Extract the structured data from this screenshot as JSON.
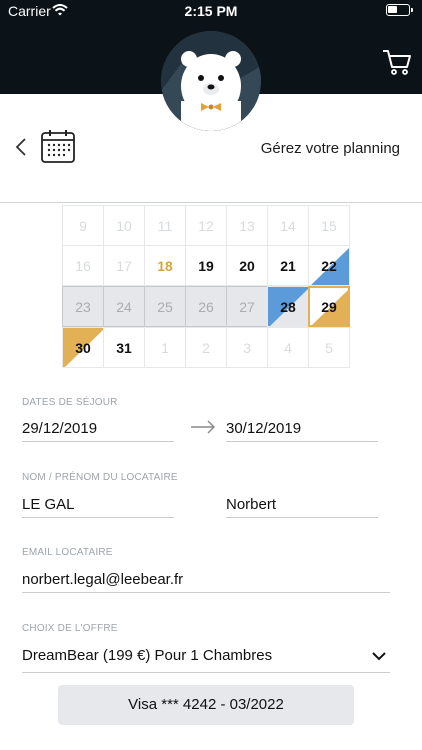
{
  "status_bar": {
    "carrier": "Carrier",
    "time": "2:15 PM"
  },
  "header": {
    "title": "Gérez votre planning"
  },
  "calendar": {
    "rows": [
      [
        {
          "d": "9",
          "s": "faded"
        },
        {
          "d": "10",
          "s": "faded"
        },
        {
          "d": "11",
          "s": "faded"
        },
        {
          "d": "12",
          "s": "faded"
        },
        {
          "d": "13",
          "s": "faded"
        },
        {
          "d": "14",
          "s": "faded"
        },
        {
          "d": "15",
          "s": "faded"
        }
      ],
      [
        {
          "d": "16",
          "s": "faded"
        },
        {
          "d": "17",
          "s": "faded"
        },
        {
          "d": "18",
          "s": "today"
        },
        {
          "d": "19",
          "s": "active"
        },
        {
          "d": "20",
          "s": "active"
        },
        {
          "d": "21",
          "s": "active"
        },
        {
          "d": "22",
          "s": "active-blue-start"
        }
      ],
      [
        {
          "d": "23",
          "s": "booked"
        },
        {
          "d": "24",
          "s": "booked"
        },
        {
          "d": "25",
          "s": "booked"
        },
        {
          "d": "26",
          "s": "booked"
        },
        {
          "d": "27",
          "s": "booked"
        },
        {
          "d": "28",
          "s": "blue-end"
        },
        {
          "d": "29",
          "s": "sel-end"
        }
      ],
      [
        {
          "d": "30",
          "s": "sel-start"
        },
        {
          "d": "31",
          "s": "active"
        },
        {
          "d": "1",
          "s": "faded"
        },
        {
          "d": "2",
          "s": "faded"
        },
        {
          "d": "3",
          "s": "faded"
        },
        {
          "d": "4",
          "s": "faded"
        },
        {
          "d": "5",
          "s": "faded"
        }
      ]
    ],
    "colors": {
      "blue": "#5b9bd9",
      "gold": "#e2b055",
      "booked": "#e5e7ea"
    }
  },
  "form": {
    "dates_label": "DATES DE SÉJOUR",
    "date_start": "29/12/2019",
    "date_end": "30/12/2019",
    "name_label": "NOM / PRÉNOM DU LOCATAIRE",
    "last_name": "LE GAL",
    "first_name": "Norbert",
    "email_label": "EMAIL LOCATAIRE",
    "email": "norbert.legal@leebear.fr",
    "offer_label": "CHOIX DE L'OFFRE",
    "offer": "DreamBear (199 €) Pour 1 Chambres",
    "payment_button": "Visa *** 4242 - 03/2022"
  }
}
